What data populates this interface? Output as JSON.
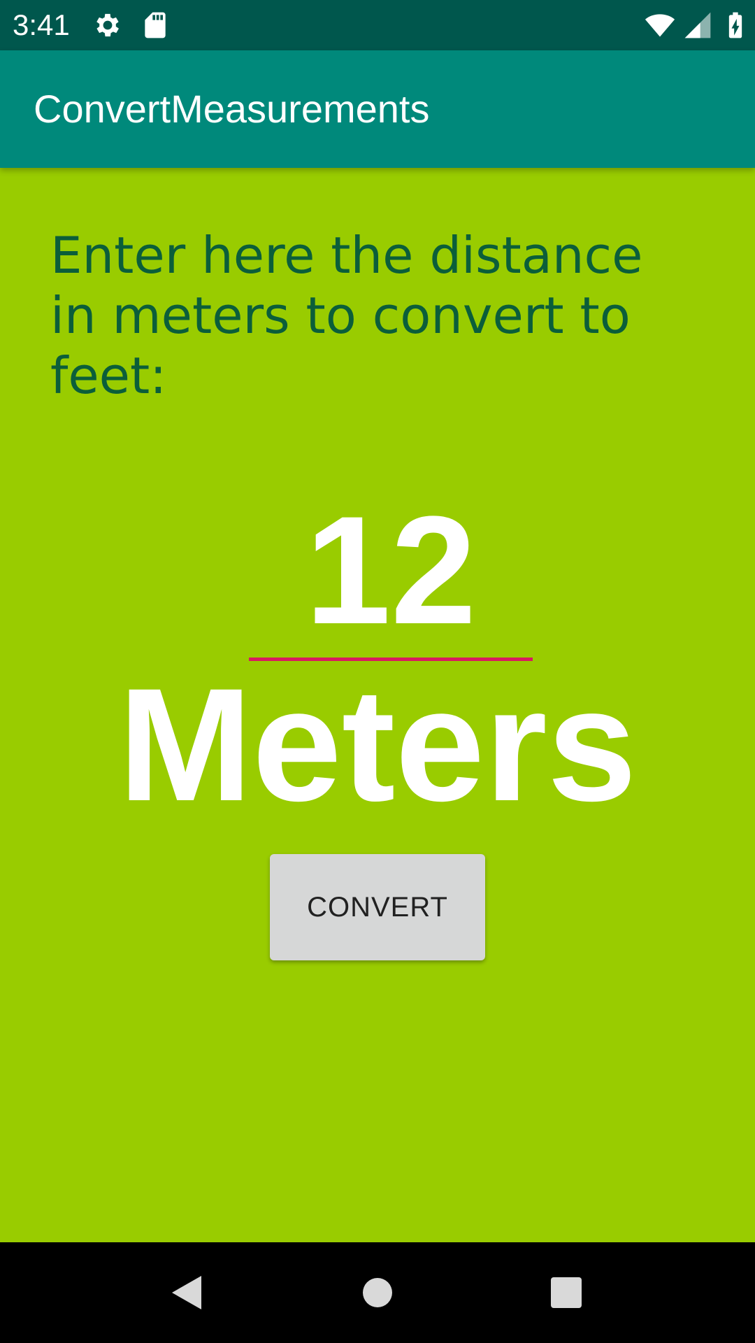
{
  "status_bar": {
    "time": "3:41",
    "icons": [
      "settings-icon",
      "sd-card-icon",
      "wifi-icon",
      "signal-icon",
      "battery-charging-icon"
    ]
  },
  "app_bar": {
    "title": "ConvertMeasurements"
  },
  "main": {
    "prompt": "Enter here the distance in meters to convert to feet:",
    "input_value": "12",
    "unit_label": "Meters",
    "convert_label": "CONVERT"
  },
  "nav_bar": {
    "icons": [
      "back-icon",
      "home-icon",
      "recents-icon"
    ]
  },
  "colors": {
    "status_bar": "#00574d",
    "app_bar": "#00897b",
    "background": "#99cc00",
    "prompt_text": "#0b5e3a",
    "input_underline": "#d81b60",
    "button": "#d6d7d7"
  }
}
